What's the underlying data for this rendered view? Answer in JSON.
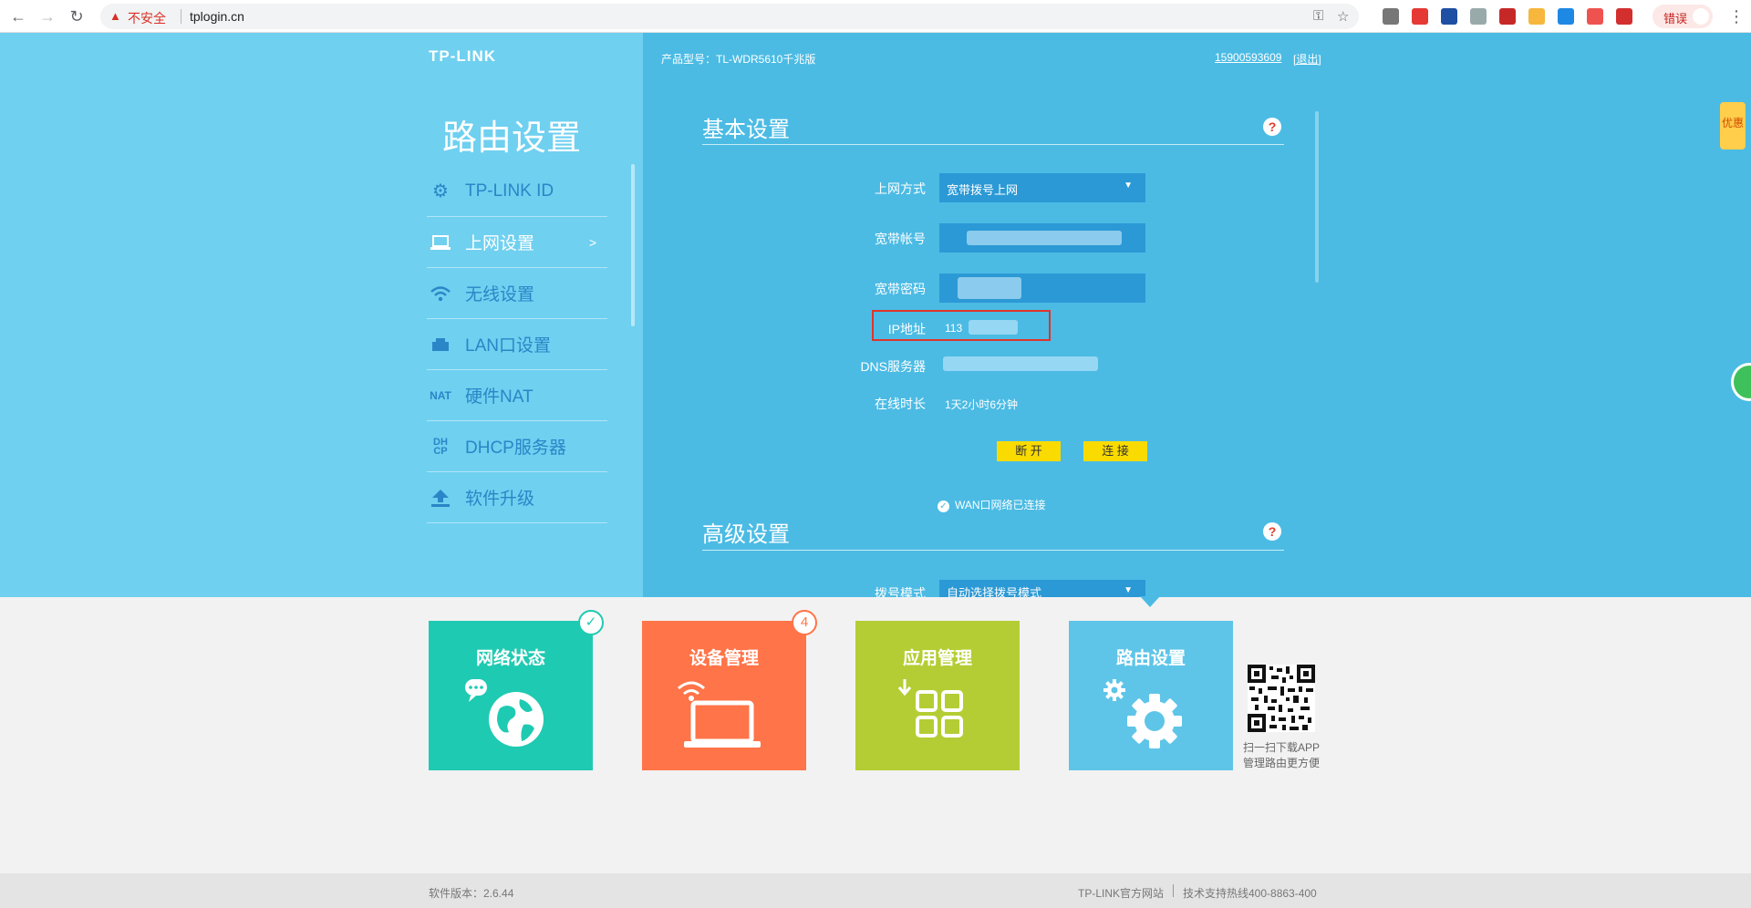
{
  "browser": {
    "security_label": "不安全",
    "url": "tplogin.cn",
    "error_label": "错误"
  },
  "header": {
    "logo": "TP-LINK",
    "model": "产品型号：TL-WDR5610千兆版",
    "account": "15900593609",
    "logout": "[退出]"
  },
  "sidebar": {
    "title": "路由设置",
    "items": [
      {
        "label": "TP-LINK ID",
        "icon": "gear-icon"
      },
      {
        "label": "上网设置",
        "icon": "laptop-icon",
        "active": true,
        "arrow": ">"
      },
      {
        "label": "无线设置",
        "icon": "wifi-icon"
      },
      {
        "label": "LAN口设置",
        "icon": "lan-icon"
      },
      {
        "label": "硬件NAT",
        "icon": "nat-icon"
      },
      {
        "label": "DHCP服务器",
        "icon": "dhcp-icon"
      },
      {
        "label": "软件升级",
        "icon": "upload-icon"
      }
    ]
  },
  "basic": {
    "title": "基本设置",
    "help": "?",
    "fields": {
      "mode_label": "上网方式",
      "mode_value": "宽带拨号上网",
      "account_label": "宽带帐号",
      "password_label": "宽带密码",
      "ip_label": "IP地址",
      "ip_value": "113",
      "dns_label": "DNS服务器",
      "uptime_label": "在线时长",
      "uptime_value": "1天2小时6分钟"
    },
    "disconnect_label": "断 开",
    "connect_label": "连 接",
    "wan_status": "WAN口网络已连接"
  },
  "advanced": {
    "title": "高级设置",
    "help": "?",
    "dial_label": "拨号模式",
    "dial_value": "自动选择拨号模式"
  },
  "tiles": [
    {
      "label": "网络状态",
      "color": "#1fcab2",
      "badge": "✓",
      "icon": "globe-icon"
    },
    {
      "label": "设备管理",
      "color": "#ff7448",
      "badge": "4",
      "icon": "laptop-wifi-icon"
    },
    {
      "label": "应用管理",
      "color": "#b4cd34",
      "icon": "apps-icon"
    },
    {
      "label": "路由设置",
      "color": "#5ec5e8",
      "icon": "gears-icon"
    }
  ],
  "qr_text": [
    "扫一扫下载APP",
    "管理路由更方便"
  ],
  "footer": {
    "version": "软件版本：2.6.44",
    "site": "TP-LINK官方网站",
    "hotline": "技术支持热线400-8863-400"
  },
  "promo": "优惠"
}
